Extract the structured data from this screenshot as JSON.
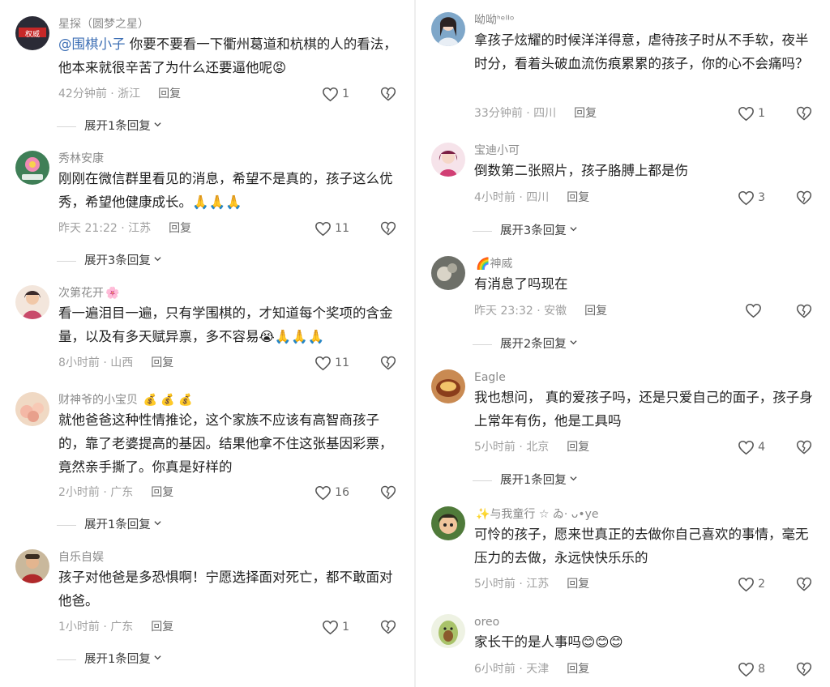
{
  "left": [
    {
      "name": "星探（圆梦之星）",
      "name_emoji": "",
      "mention": "@围棋小子",
      "text": "你要不要看一下衢州葛道和杭棋的人的看法，他本来就很辛苦了为什么还要逼他呢😡",
      "time_loc": "42分钟前 · 浙江",
      "reply": "回复",
      "likes": "1",
      "expand": "展开1条回复"
    },
    {
      "name": "秀林安康",
      "name_emoji": "",
      "mention": "",
      "text": "刚刚在微信群里看见的消息，希望不是真的，孩子这么优秀，希望他健康成长。🙏🙏🙏",
      "time_loc": "昨天 21:22 · 江苏",
      "reply": "回复",
      "likes": "11",
      "expand": "展开3条回复"
    },
    {
      "name": "次第花开",
      "name_emoji": "🌸",
      "mention": "",
      "text": "看一遍泪目一遍，只有学围棋的，才知道每个奖项的含金量，以及有多天赋异禀，多不容易😭🙏🙏🙏",
      "time_loc": "8小时前 · 山西",
      "reply": "回复",
      "likes": "11",
      "expand": ""
    },
    {
      "name": "财神爷的小宝贝",
      "name_emoji": "💰 💰 💰",
      "mention": "",
      "text": "就他爸爸这种性情推论，这个家族不应该有高智商孩子的，靠了老婆提高的基因。结果他拿不住这张基因彩票，竟然亲手撕了。你真是好样的",
      "time_loc": "2小时前 · 广东",
      "reply": "回复",
      "likes": "16",
      "expand": "展开1条回复"
    },
    {
      "name": "自乐自娱",
      "name_emoji": "",
      "mention": "",
      "text": "孩子对他爸是多恐惧啊！宁愿选择面对死亡，都不敢面对他爸。",
      "time_loc": "1小时前 · 广东",
      "reply": "回复",
      "likes": "1",
      "expand": "展开1条回复"
    }
  ],
  "right": [
    {
      "name": "呦呦ᑋᵉᑊᑊᵒ",
      "name_emoji": "",
      "mention": "",
      "text": "拿孩子炫耀的时候洋洋得意，虐待孩子时从不手软，夜半时分，看着头破血流伤痕累累的孩子，你的心不会痛吗？",
      "time_loc": "33分钟前 · 四川",
      "reply": "回复",
      "likes": "1",
      "expand": ""
    },
    {
      "name": "宝迪小可",
      "name_emoji": "",
      "mention": "",
      "text": "倒数第二张照片，孩子胳膊上都是伤",
      "time_loc": "4小时前 · 四川",
      "reply": "回复",
      "likes": "3",
      "expand": "展开3条回复"
    },
    {
      "name": "神威",
      "name_emoji": "🌈",
      "mention": "",
      "text": "有消息了吗现在",
      "time_loc": "昨天 23:32 · 安徽",
      "reply": "回复",
      "likes": "",
      "expand": "展开2条回复"
    },
    {
      "name": "Eagle",
      "name_emoji": "",
      "mention": "",
      "text": "我也想问， 真的爱孩子吗，还是只爱自己的面子，孩子身上常年有伤，他是工具吗",
      "time_loc": "5小时前 · 北京",
      "reply": "回复",
      "likes": "4",
      "expand": "展开1条回复"
    },
    {
      "name": "与我童行 ☆ ゐ· ᴗ•ye",
      "name_emoji": "✨",
      "mention": "",
      "text": "可怜的孩子，愿来世真正的去做你自己喜欢的事情，毫无压力的去做，永远快快乐乐的",
      "time_loc": "5小时前 · 江苏",
      "reply": "回复",
      "likes": "2",
      "expand": ""
    },
    {
      "name": "oreo",
      "name_emoji": "",
      "mention": "",
      "text": "家长干的是人事吗😊😊😊",
      "time_loc": "6小时前 · 天津",
      "reply": "回复",
      "likes": "8",
      "expand": ""
    }
  ],
  "colors": {
    "mention": "#3d6fb5",
    "meta": "#a0a0a0",
    "name": "#8a8a8a",
    "text": "#1f1f1f"
  }
}
